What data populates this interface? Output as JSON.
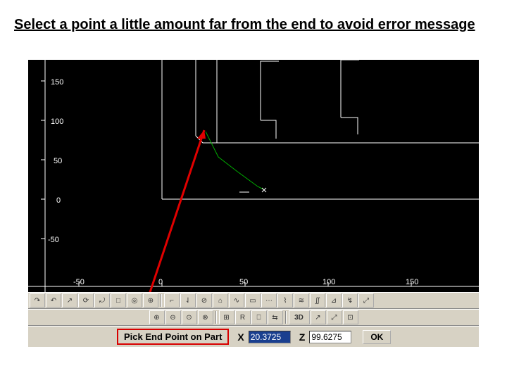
{
  "instruction": "Select a point a little amount far from the end to avoid error message",
  "chart_data": {
    "type": "line",
    "title": "",
    "xlabel": "",
    "ylabel": "",
    "x_ticks": [
      "-50",
      "0",
      "50",
      "100",
      "150"
    ],
    "y_ticks": [
      "150",
      "100",
      "50",
      "0",
      "-50"
    ],
    "xlim": [
      -70,
      170
    ],
    "ylim": [
      -80,
      170
    ],
    "series": [
      {
        "name": "part-profile",
        "color": "#ffffff"
      },
      {
        "name": "tool-path",
        "color": "#00aa00"
      }
    ]
  },
  "toolbars": {
    "row1_icons": [
      "↷",
      "↶",
      "↗",
      "⟳",
      "⤾",
      "□",
      "◎",
      "⊕",
      "",
      "⌐",
      "⇃",
      "⊘",
      "⌂",
      "∿",
      "▭",
      "⋯",
      "⌇",
      "≋",
      "∬",
      "⊿",
      "↯",
      "⤢"
    ],
    "row2_icons": [
      "⊕",
      "⊖",
      "⊙",
      "⊗",
      "",
      "⊞",
      "R",
      "⎕",
      "⇆",
      "",
      "3D",
      "↗",
      "⤢",
      "⊡",
      ""
    ]
  },
  "prompt": "Pick End Point on Part",
  "coords": {
    "x_label": "X",
    "x_value": "20.3725",
    "z_label": "Z",
    "z_value": "99.6275"
  },
  "ok_label": "OK"
}
